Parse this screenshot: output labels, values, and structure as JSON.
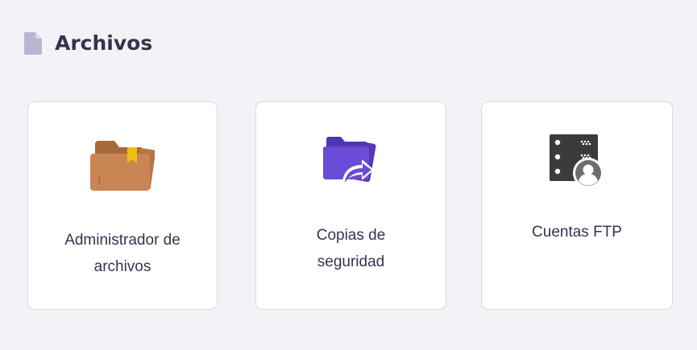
{
  "section": {
    "title": "Archivos",
    "icon": "file-icon"
  },
  "cards": [
    {
      "label_line1": "Administrador de",
      "label_line2": "archivos",
      "icon": "file-manager-folder-icon"
    },
    {
      "label_line1": "Copias de",
      "label_line2": "seguridad",
      "icon": "backup-folder-icon"
    },
    {
      "label_line1": "Cuentas FTP",
      "icon": "ftp-accounts-icon"
    }
  ],
  "colors": {
    "background": "#f2f3f6",
    "card": "#ffffff",
    "title": "#36344d",
    "file_manager_folder": "#c98552",
    "backup_folder": "#6b4cd6",
    "ftp_icon": "#3b3b3b"
  }
}
